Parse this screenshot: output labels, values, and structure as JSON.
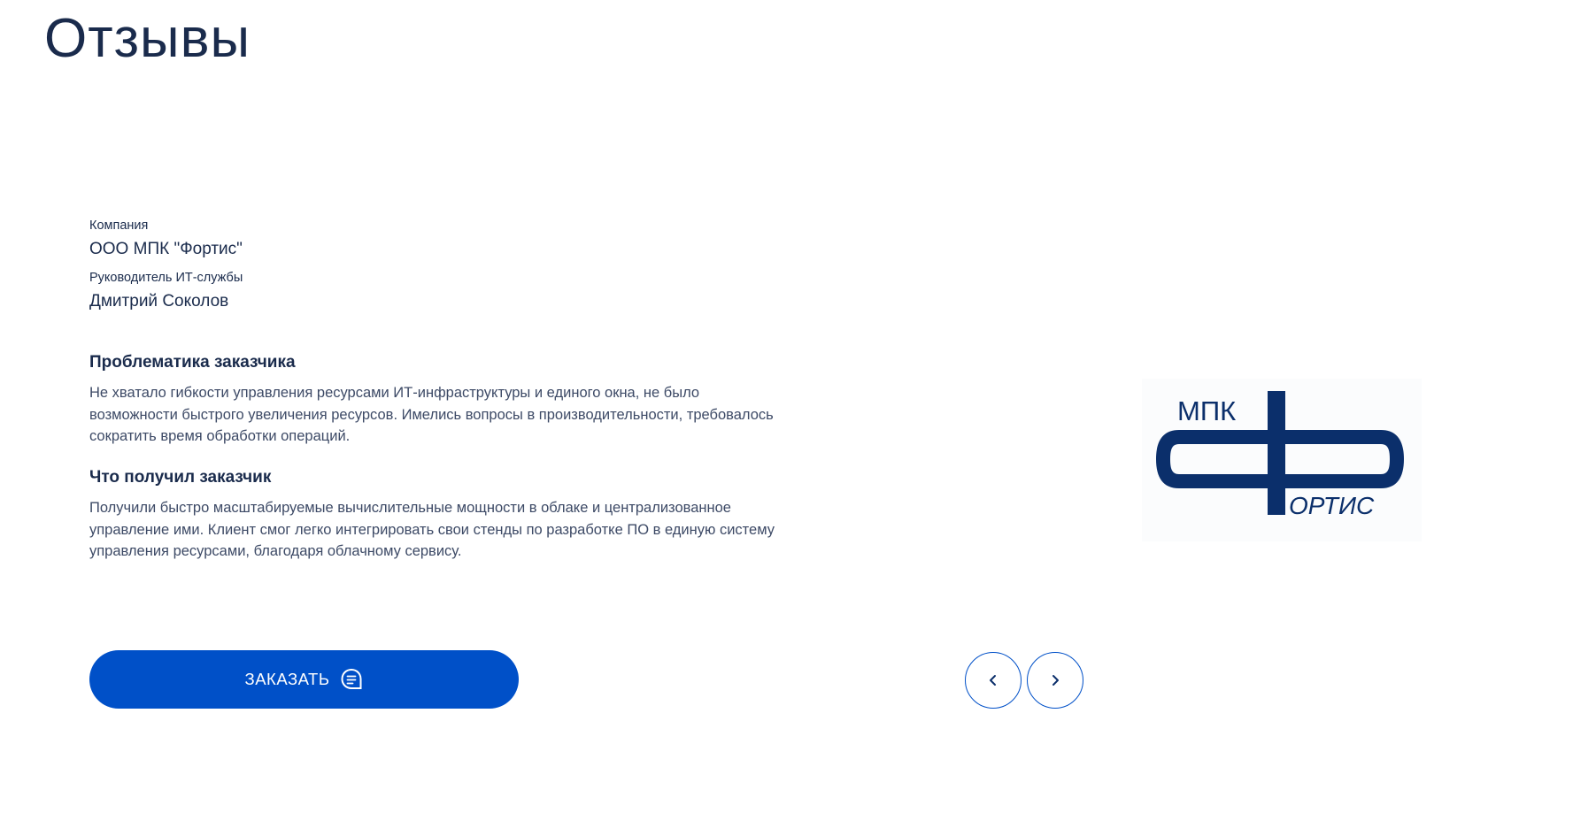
{
  "page": {
    "title": "Отзывы"
  },
  "review": {
    "company_label": "Компания",
    "company_name": "ООО МПК \"Фортис\"",
    "person_label": "Руководитель ИТ-службы",
    "person_name": "Дмитрий Соколов",
    "problem_title": "Проблематика заказчика",
    "problem_text": "Не хватало гибкости управления ресурсами ИТ-инфраструктуры и единого окна, не было возможности быстрого увеличения ресурсов. Имелись вопросы в производительности, требовалось сократить время обработки операций.",
    "result_title": "Что получил заказчик",
    "result_text": "Получили быстро масштабируемые вычислительные мощности в облаке и централизованное управление ими. Клиент смог легко интегрировать свои стенды по разработке ПО в единую систему управления ресурсами, благодаря облачному сервису.",
    "logo": {
      "top_text": "МПК",
      "bottom_text": "ОРТИС",
      "color": "#0b2f6b"
    }
  },
  "actions": {
    "order_label": "ЗАКАЗАТЬ",
    "order_icon": "chat-bubble-icon",
    "prev_icon": "chevron-left-icon",
    "next_icon": "chevron-right-icon"
  },
  "colors": {
    "primary": "#0050c8",
    "heading": "#1a2b4c",
    "body_text": "#3d4a66",
    "logo": "#0b2f6b"
  }
}
